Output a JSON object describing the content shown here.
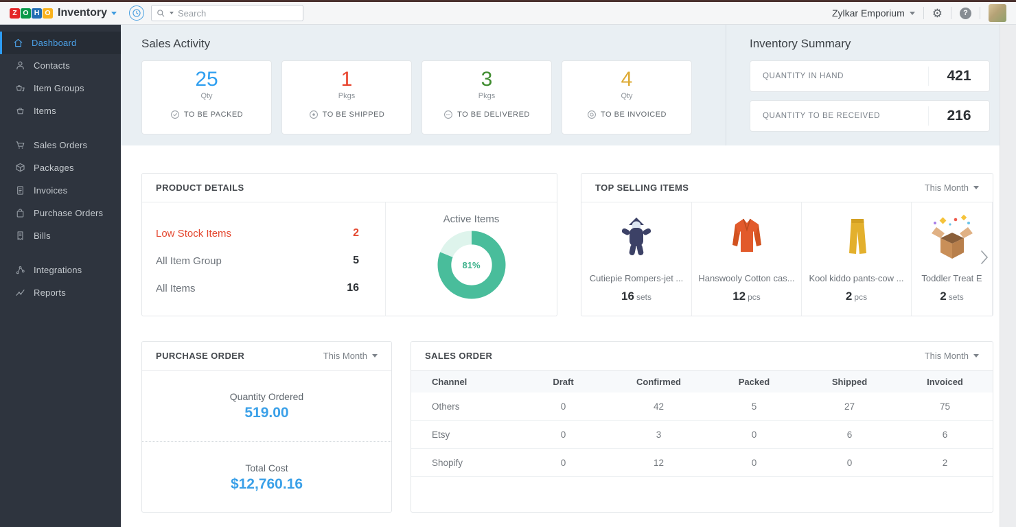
{
  "topbar": {
    "logo_letters": [
      "Z",
      "O",
      "H",
      "O"
    ],
    "logo_colors": [
      "#e42527",
      "#089949",
      "#226db4",
      "#f9b21d"
    ],
    "app_name": "Inventory",
    "search": {
      "placeholder": "Search"
    },
    "org_name": "Zylkar Emporium",
    "icons": [
      "history-icon",
      "gear-icon",
      "help-icon",
      "user-avatar"
    ]
  },
  "sidebar": {
    "items": [
      {
        "label": "Dashboard",
        "icon": "home-icon",
        "active": true
      },
      {
        "label": "Contacts",
        "icon": "person-icon"
      },
      {
        "label": "Item Groups",
        "icon": "item-groups-icon"
      },
      {
        "label": "Items",
        "icon": "item-icon"
      },
      {
        "label": "Sales Orders",
        "icon": "cart-icon"
      },
      {
        "label": "Packages",
        "icon": "package-icon"
      },
      {
        "label": "Invoices",
        "icon": "invoice-icon"
      },
      {
        "label": "Purchase Orders",
        "icon": "bag-icon"
      },
      {
        "label": "Bills",
        "icon": "bill-icon"
      },
      {
        "label": "Integrations",
        "icon": "integrations-icon"
      },
      {
        "label": "Reports",
        "icon": "reports-icon"
      }
    ]
  },
  "sales_activity": {
    "title": "Sales Activity",
    "cards": [
      {
        "value": "25",
        "unit": "Qty",
        "label": "TO BE PACKED",
        "color": "#2f9ff0",
        "icon": "check-circle-icon"
      },
      {
        "value": "1",
        "unit": "Pkgs",
        "label": "TO BE SHIPPED",
        "color": "#e8432d",
        "icon": "target-circle-icon"
      },
      {
        "value": "3",
        "unit": "Pkgs",
        "label": "TO BE DELIVERED",
        "color": "#3f8c2f",
        "icon": "dots-circle-icon"
      },
      {
        "value": "4",
        "unit": "Qty",
        "label": "TO BE INVOICED",
        "color": "#ddaa33",
        "icon": "invoice-circle-icon"
      }
    ]
  },
  "inventory_summary": {
    "title": "Inventory Summary",
    "rows": [
      {
        "label": "QUANTITY IN HAND",
        "value": "421"
      },
      {
        "label": "QUANTITY TO BE RECEIVED",
        "value": "216"
      }
    ]
  },
  "product_details": {
    "title": "PRODUCT DETAILS",
    "rows": [
      {
        "label": "Low Stock Items",
        "value": "2",
        "alert": true
      },
      {
        "label": "All Item Group",
        "value": "5"
      },
      {
        "label": "All Items",
        "value": "16"
      }
    ],
    "donut": {
      "title": "Active Items",
      "percent": "81%",
      "value": 81,
      "color": "#49bd9b",
      "track_color": "#def4ec"
    }
  },
  "top_selling": {
    "title": "TOP SELLING ITEMS",
    "period": "This Month",
    "items": [
      {
        "name": "Cutiepie Rompers-jet ...",
        "qty": "16",
        "unit": "sets",
        "image": "romper-image"
      },
      {
        "name": "Hanswooly Cotton cas...",
        "qty": "12",
        "unit": "pcs",
        "image": "cardigan-image"
      },
      {
        "name": "Kool kiddo pants-cow ...",
        "qty": "2",
        "unit": "pcs",
        "image": "pants-image"
      },
      {
        "name": "Toddler Treat E",
        "qty": "2",
        "unit": "sets",
        "image": "box-image"
      }
    ]
  },
  "purchase_order": {
    "title": "PURCHASE ORDER",
    "period": "This Month",
    "metrics": [
      {
        "label": "Quantity Ordered",
        "value": "519.00"
      },
      {
        "label": "Total Cost",
        "value": "$12,760.16"
      }
    ]
  },
  "sales_order": {
    "title": "SALES ORDER",
    "period": "This Month",
    "columns": [
      "Channel",
      "Draft",
      "Confirmed",
      "Packed",
      "Shipped",
      "Invoiced"
    ],
    "rows": [
      {
        "channel": "Others",
        "values": [
          "0",
          "42",
          "5",
          "27",
          "75"
        ]
      },
      {
        "channel": "Etsy",
        "values": [
          "0",
          "3",
          "0",
          "6",
          "6"
        ]
      },
      {
        "channel": "Shopify",
        "values": [
          "0",
          "12",
          "0",
          "0",
          "2"
        ]
      }
    ]
  },
  "colors": {
    "sidebar_bg": "#2e343e",
    "active_item_blue": "#4ba0e6",
    "band_bg": "#e9eff3",
    "value_blue": "#3aa0e8",
    "alert_red": "#e4472f",
    "top_strip": "#4a312e"
  }
}
